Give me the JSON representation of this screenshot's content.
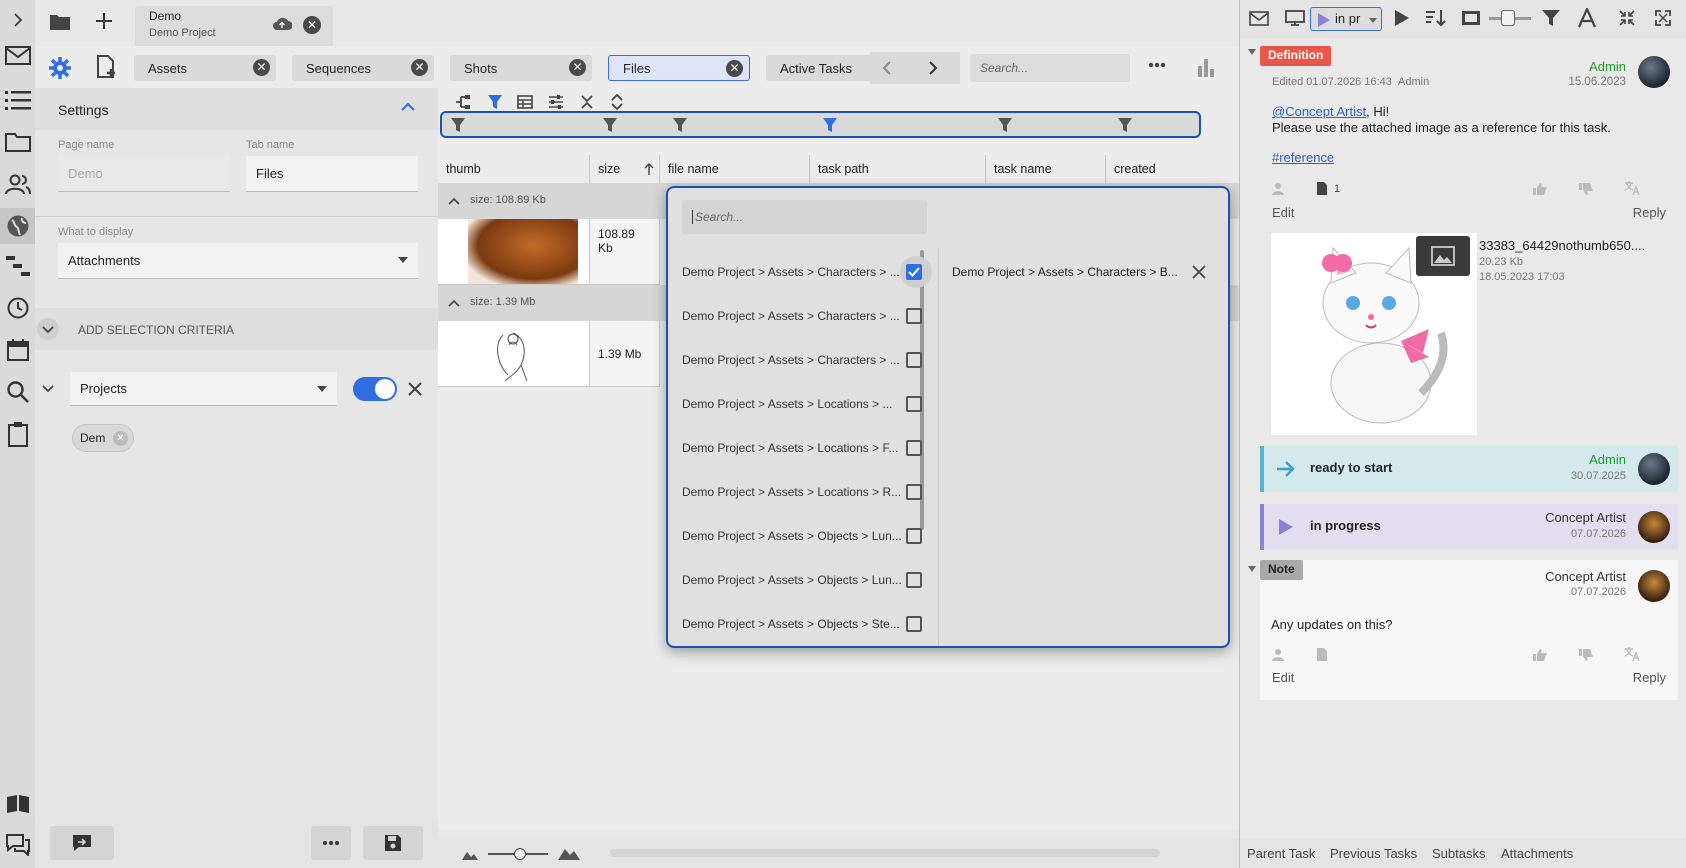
{
  "project_tab": {
    "title": "Demo",
    "subtitle": "Demo Project"
  },
  "tabs": [
    {
      "label": "Assets"
    },
    {
      "label": "Sequences"
    },
    {
      "label": "Shots"
    },
    {
      "label": "Files"
    },
    {
      "label": "Active Tasks"
    }
  ],
  "top_search": {
    "placeholder": "Search..."
  },
  "settings": {
    "title": "Settings",
    "page_name_label": "Page name",
    "page_name_value": "Demo",
    "tab_name_label": "Tab name",
    "tab_name_value": "Files",
    "display_label": "What to display",
    "display_value": "Attachments",
    "add_criteria": "ADD SELECTION CRITERIA",
    "criteria_select": "Projects",
    "chip": "Dem"
  },
  "grid": {
    "columns": [
      "thumb",
      "size",
      "file name",
      "task path",
      "task name",
      "created"
    ],
    "groups": [
      {
        "label": "size: 108.89 Kb",
        "size_line1": "108.89",
        "size_line2": "Kb"
      },
      {
        "label": "size: 1.39 Mb",
        "size_line1": "1.39 Mb",
        "size_line2": ""
      }
    ]
  },
  "popup": {
    "search_placeholder": "Search...",
    "options": [
      {
        "label": "Demo Project > Assets > Characters > ...",
        "checked": true
      },
      {
        "label": "Demo Project > Assets > Characters > ...",
        "checked": false
      },
      {
        "label": "Demo Project > Assets > Characters > ...",
        "checked": false
      },
      {
        "label": "Demo Project > Assets > Locations > ...",
        "checked": false
      },
      {
        "label": "Demo Project > Assets > Locations > F...",
        "checked": false
      },
      {
        "label": "Demo Project > Assets > Locations > R...",
        "checked": false
      },
      {
        "label": "Demo Project > Assets > Objects > Lun...",
        "checked": false
      },
      {
        "label": "Demo Project > Assets > Objects > Lun...",
        "checked": false
      },
      {
        "label": "Demo Project > Assets > Objects > Ste...",
        "checked": false
      }
    ],
    "selected": "Demo Project > Assets > Characters > B..."
  },
  "rtoolbar": {
    "status_select": "in pr"
  },
  "right_panel": {
    "definition": {
      "tag": "Definition",
      "edited": "Edited 01.07.2026 16:43",
      "edited_by": "Admin",
      "author": "Admin",
      "date": "15.06.2023",
      "mention": "@Concept Artist",
      "greeting": ", Hi!",
      "body": "Please use the attached image as a reference for this task.",
      "hashtag": "#reference",
      "attach_count": "1",
      "edit": "Edit",
      "reply": "Reply",
      "file_name": "33383_64429nothumb650....",
      "file_size": "20.23 Kb",
      "file_date": "18.05.2023 17:03"
    },
    "status1": {
      "label": "ready to start",
      "author": "Admin",
      "date": "30.07.2025"
    },
    "status2": {
      "label": "in progress",
      "author": "Concept Artist",
      "date": "07.07.2026"
    },
    "note": {
      "tag": "Note",
      "author": "Concept Artist",
      "date": "07.07.2026",
      "body": "Any updates on this?",
      "edit": "Edit",
      "reply": "Reply"
    },
    "bottom_tabs": [
      "Parent Task",
      "Previous Tasks",
      "Subtasks",
      "Attachments"
    ]
  },
  "colors": {
    "accent": "#2f6de0",
    "definition_tag": "#e8574a",
    "note_tag": "#a9a9a9",
    "ready_bg": "#d4e9ee",
    "progress_bg": "#e2def0"
  }
}
